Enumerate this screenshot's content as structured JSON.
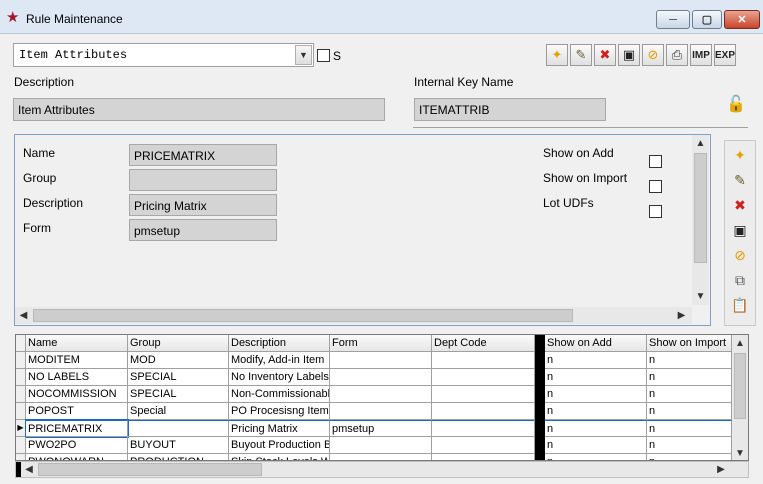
{
  "window": {
    "title": "Rule Maintenance",
    "minimize_glyph": "─",
    "maximize_glyph": "▢",
    "close_glyph": "✕",
    "app_icon": "star-icon"
  },
  "rule_select": {
    "value": "Item Attributes",
    "s_label": "S"
  },
  "toolbar": {
    "imp_label": "IMP",
    "exp_label": "EXP"
  },
  "header": {
    "description_label": "Description",
    "description_value": "Item Attributes",
    "key_label": "Internal Key Name",
    "key_value": "ITEMATTRIB"
  },
  "detail": {
    "name_label": "Name",
    "name_value": "PRICEMATRIX",
    "group_label": "Group",
    "group_value": "",
    "description_label": "Description",
    "description_value": "Pricing Matrix",
    "form_label": "Form",
    "form_value": "pmsetup",
    "show_on_add_label": "Show on Add",
    "show_on_import_label": "Show on Import",
    "lot_udfs_label": "Lot UDFs"
  },
  "grid": {
    "columns": [
      "Name",
      "Group",
      "Description",
      "Form",
      "Dept Code",
      "Show on Add",
      "Show on Import"
    ],
    "rows": [
      [
        "MODITEM",
        "MOD",
        "Modify, Add-in Item",
        "",
        "",
        "n",
        "n"
      ],
      [
        "NO LABELS",
        "SPECIAL",
        "No Inventory Labels",
        "",
        "",
        "n",
        "n"
      ],
      [
        "NOCOMMISSION",
        "SPECIAL",
        "Non-Commissionable",
        "",
        "",
        "n",
        "n"
      ],
      [
        "POPOST",
        "Special",
        "PO Procesisng Item",
        "",
        "",
        "n",
        "n"
      ],
      [
        "PRICEMATRIX",
        "",
        "Pricing Matrix",
        "pmsetup",
        "",
        "n",
        "n"
      ],
      [
        "PWO2PO",
        "BUYOUT",
        "Buyout Production B",
        "",
        "",
        "n",
        "n"
      ],
      [
        "PWONOWARN",
        "PRODUCTION",
        "Skip Stock Levels W",
        "",
        "",
        "n",
        "n"
      ]
    ]
  },
  "colors": {
    "title_bar": "#dde8f4",
    "accent_blue": "#1c68c4",
    "panel_border": "#7fa0c8",
    "lock_green": "#129c2b"
  }
}
